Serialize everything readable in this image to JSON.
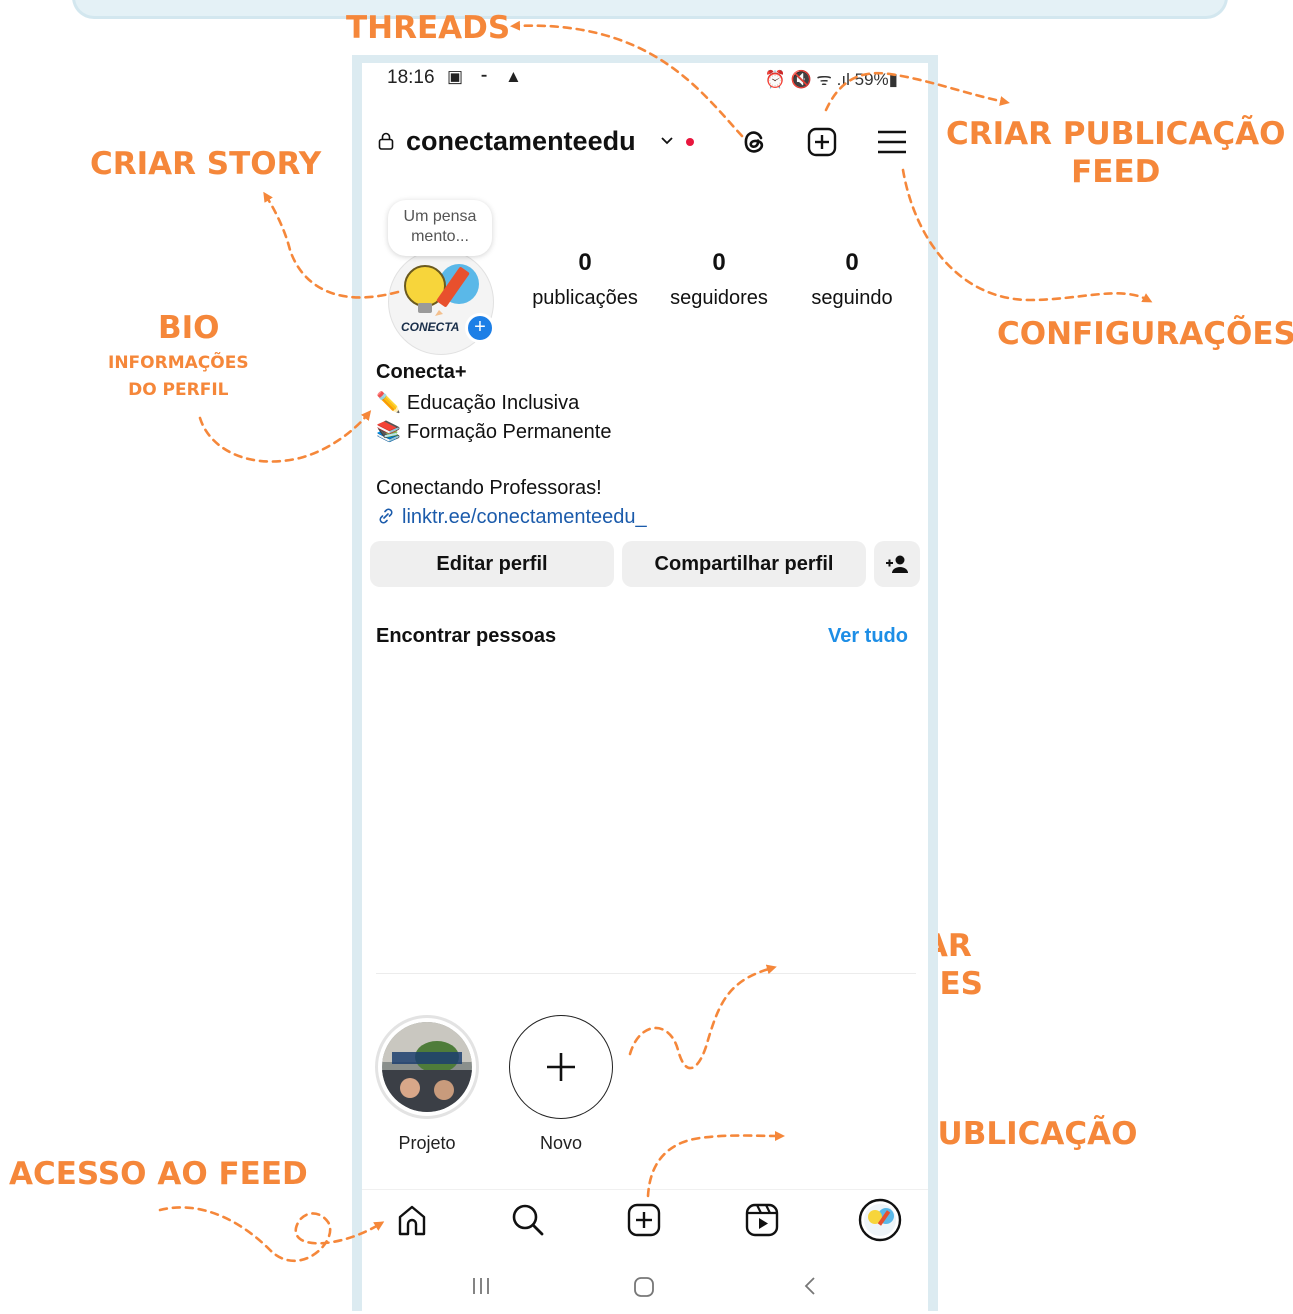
{
  "annotations": {
    "threads": "THREADS",
    "criar_publicacao_feed_1": "CRIAR PUBLICAÇÃO",
    "criar_publicacao_feed_2": "FEED",
    "criar_story": "CRIAR STORY",
    "configuracoes": "CONFIGURAÇÕES",
    "bio": "BIO",
    "bio_sub_1": "INFORMAÇÕES",
    "bio_sub_2": "DO PERFIL",
    "adicionar_destaques_1": "ADICIONAR",
    "adicionar_destaques_2": "DESTAQUES",
    "criar_publicacao": "CRIAR PUBLICAÇÃO",
    "acesso_ao_feed": "ACESSO AO FEED"
  },
  "status_bar": {
    "time": "18:16",
    "left_icons": "▣ ⁃ ▲",
    "right_icons": "⏰ 🔇 ᯤ .ıl 59%▮"
  },
  "header": {
    "username": "conectamenteedu"
  },
  "profile": {
    "note": "Um pensa mento...",
    "avatar_text": "CONECTA",
    "stats": [
      {
        "value": "0",
        "label": "publicações"
      },
      {
        "value": "0",
        "label": "seguidores"
      },
      {
        "value": "0",
        "label": "seguindo"
      }
    ],
    "name": "Conecta+",
    "bio_lines": [
      {
        "emoji": "✏️",
        "text": "Educação Inclusiva"
      },
      {
        "emoji": "📚",
        "text": "Formação Permanente"
      }
    ],
    "tagline": "Conectando Professoras!",
    "link": "linktr.ee/conectamenteedu_"
  },
  "buttons": {
    "edit": "Editar perfil",
    "share": "Compartilhar perfil"
  },
  "suggestions": {
    "title": "Encontrar pessoas",
    "see_all": "Ver tudo"
  },
  "highlights": [
    {
      "label": "Projeto"
    },
    {
      "label": "Novo"
    }
  ],
  "colors": {
    "annotation": "#f5873a",
    "link": "#1b5bab",
    "accent_blue": "#1d8ee6",
    "frame": "#dcebf1"
  }
}
